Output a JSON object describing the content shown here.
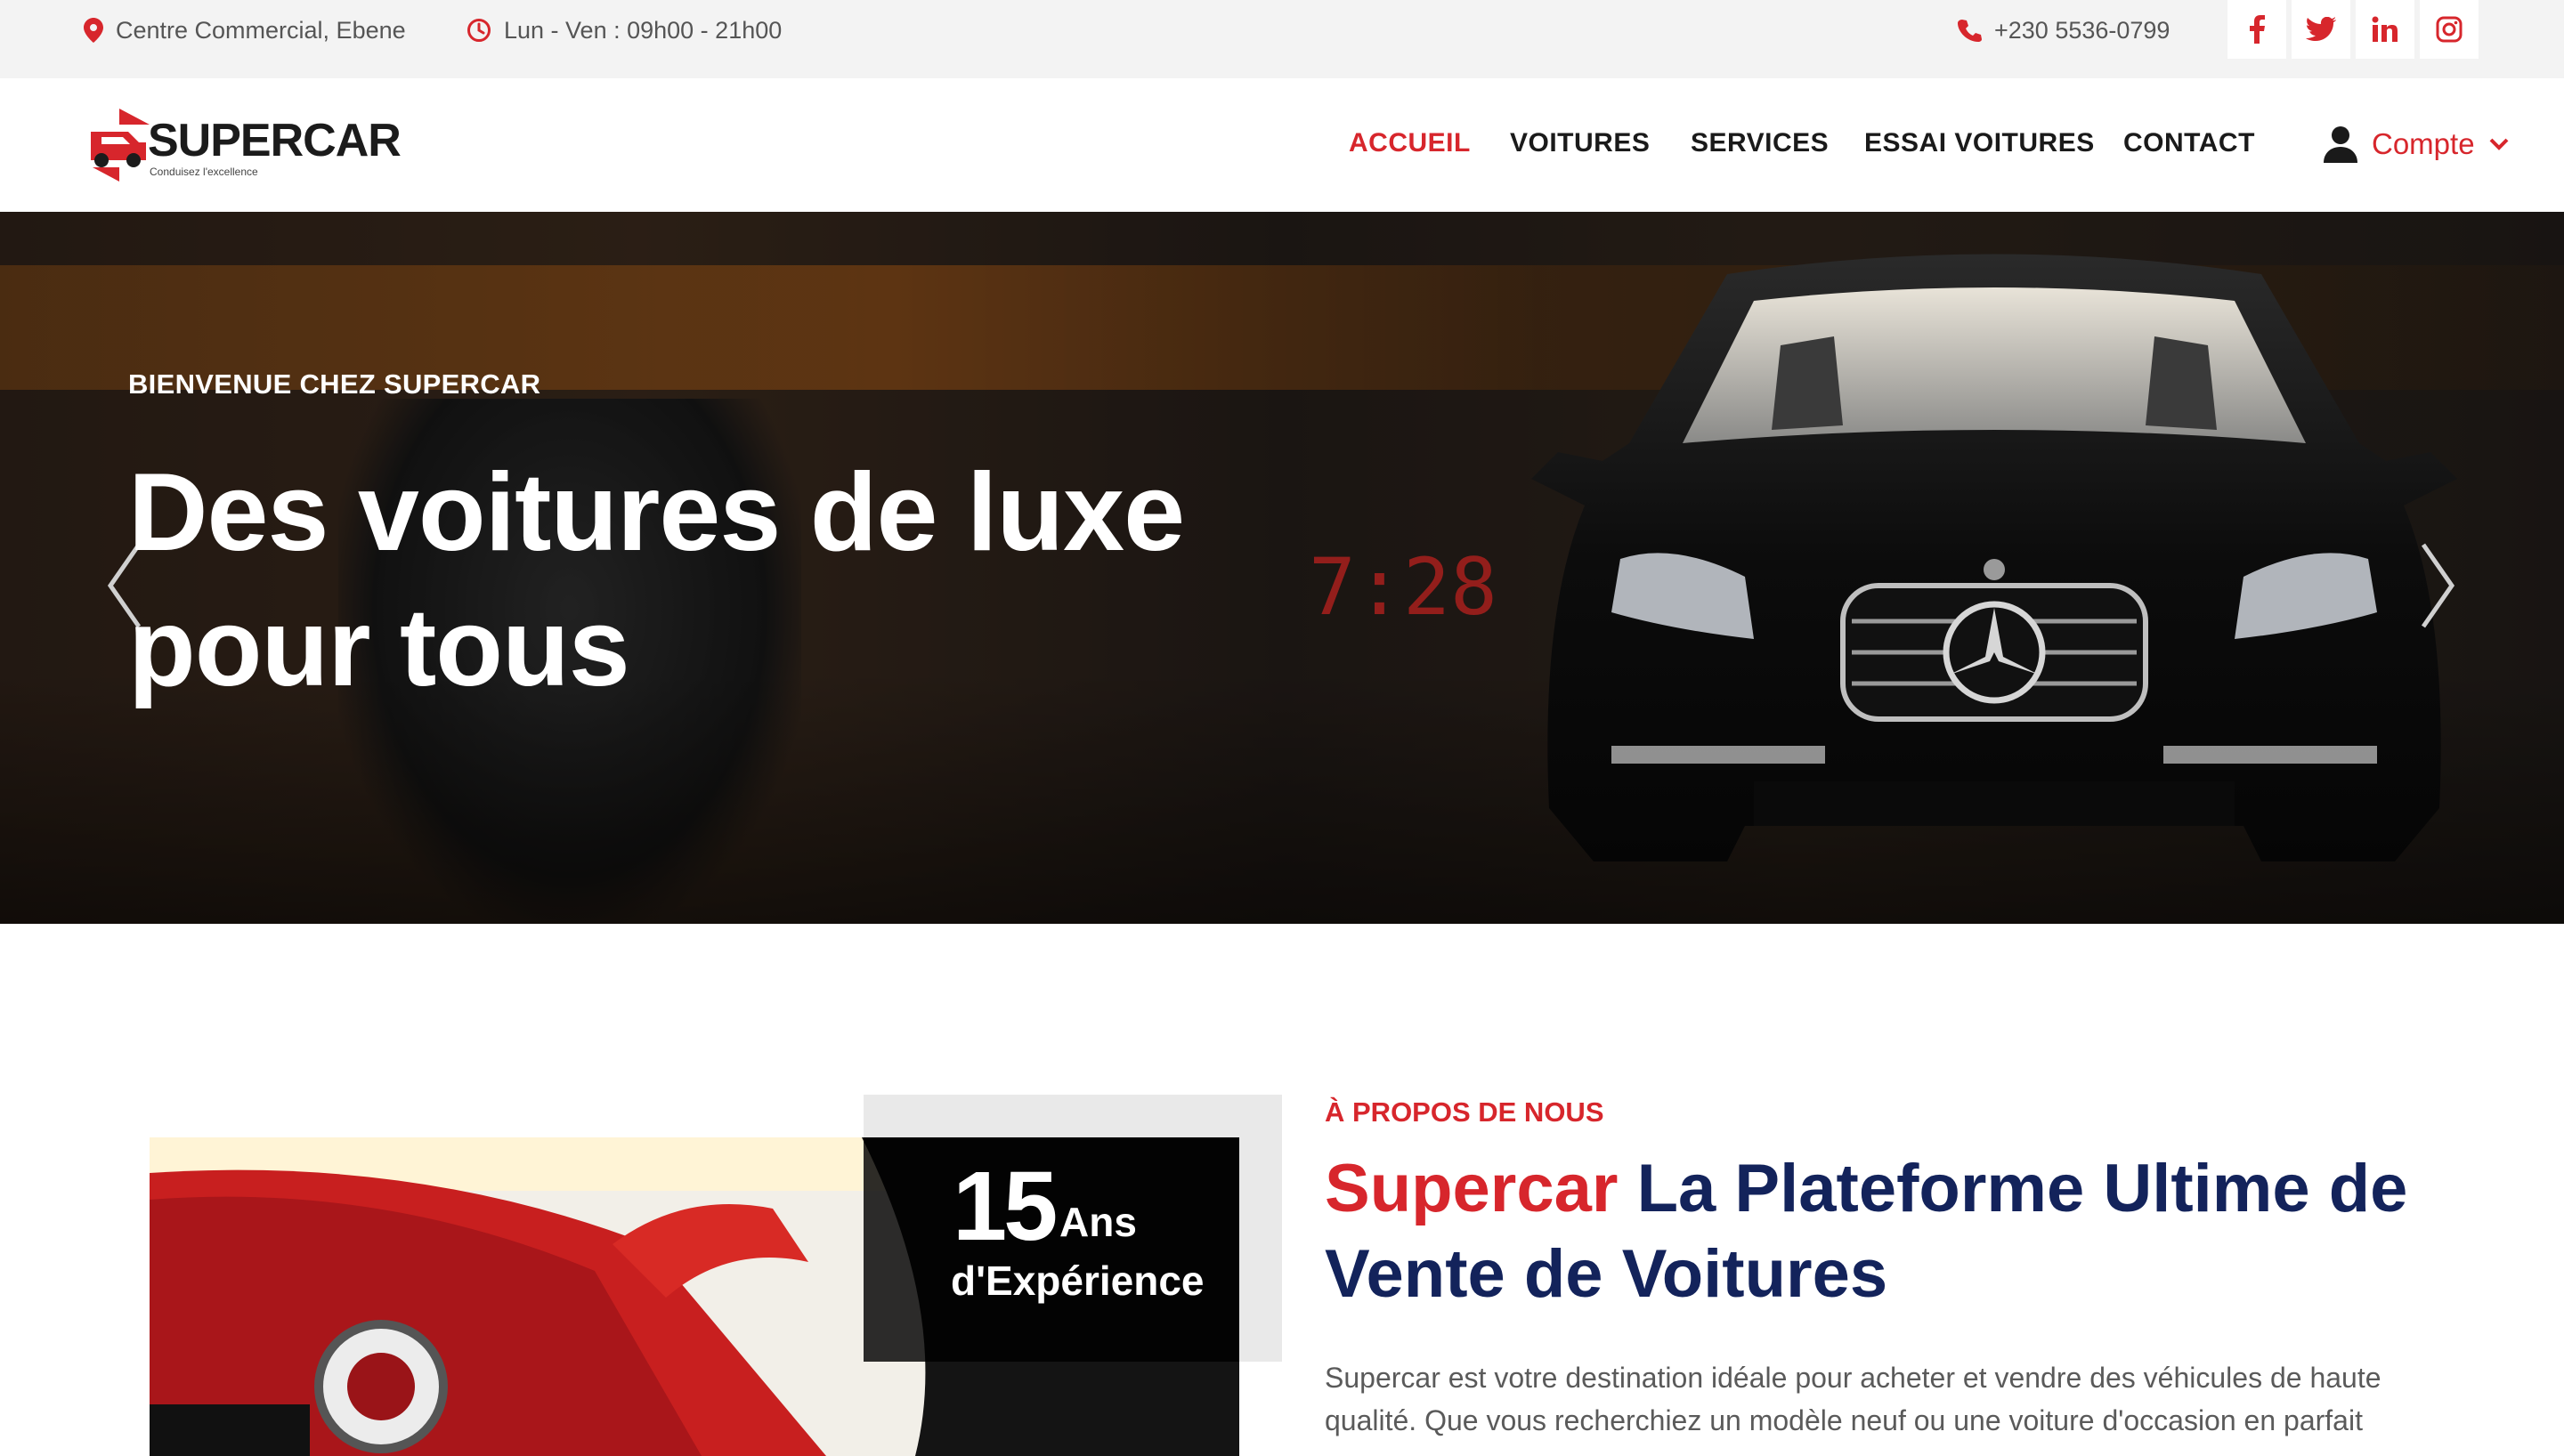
{
  "topbar": {
    "location": "Centre Commercial, Ebene",
    "hours": "Lun - Ven : 09h00 - 21h00",
    "phone": "+230 5536-0799",
    "social": [
      "facebook-icon",
      "twitter-icon",
      "linkedin-icon",
      "instagram-icon"
    ]
  },
  "navbar": {
    "logo_text": "SUPERCAR",
    "logo_tagline": "Conduisez l'excellence",
    "links": [
      "ACCUEIL",
      "VOITURES",
      "SERVICES",
      "ESSAI VOITURES",
      "CONTACT"
    ],
    "active": "ACCUEIL",
    "account_label": "Compte"
  },
  "hero": {
    "subtitle": "BIENVENUE CHEZ SUPERCAR",
    "title": "Des voitures de luxe pour tous",
    "clock": "7:28"
  },
  "about": {
    "experience_number": "15",
    "experience_unit": "Ans",
    "experience_label": "d'Expérience",
    "kicker": "À PROPOS DE NOUS",
    "title_brand": "Supercar",
    "title_rest": "La Plateforme Ultime de Vente de Voitures",
    "text": "Supercar est votre destination idéale pour acheter et vendre des véhicules de haute qualité. Que vous recherchiez un modèle neuf ou une voiture d'occasion en parfait"
  },
  "colors": {
    "accent": "#d7262c",
    "navy": "#13235b",
    "topbar_bg": "#f3f3f3"
  }
}
